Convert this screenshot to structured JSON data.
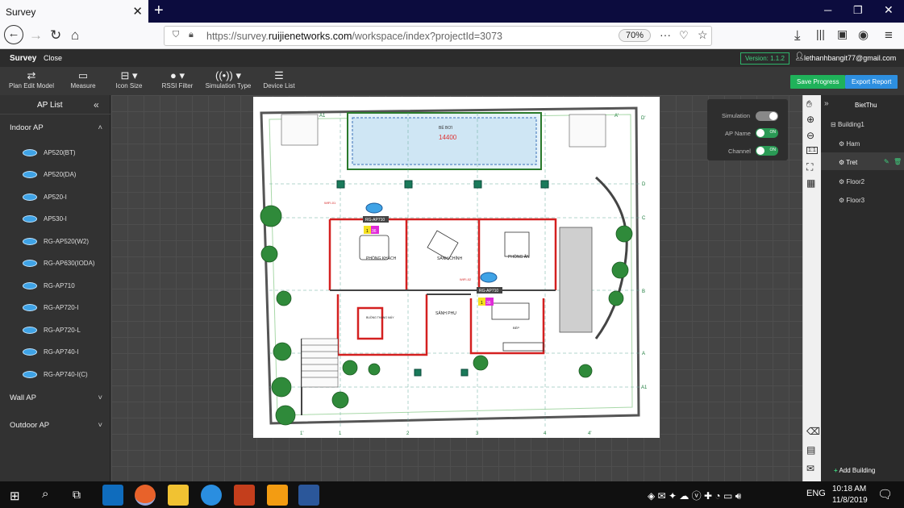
{
  "browser": {
    "tab_title": "Survey",
    "url_scheme": "https://survey.",
    "url_domain": "ruijienetworks.com",
    "url_path": "/workspace/index?projectId=3073",
    "zoom": "70%"
  },
  "header": {
    "app_name": "Survey",
    "close_label": "Close",
    "version": "Version: 1.1.2",
    "user": "lethanhbangit77@gmail.com"
  },
  "toolbar": {
    "plan_edit": "Plan Edit Model",
    "measure": "Measure",
    "icon_size": "Icon Size",
    "rssi_filter": "RSSI Filter",
    "simulation_type": "Simulation Type",
    "device_list": "Device List",
    "save_progress": "Save Progress",
    "export_report": "Export Report"
  },
  "ap_list": {
    "title": "AP List",
    "indoor": "Indoor AP",
    "items": [
      "AP520(BT)",
      "AP520(DA)",
      "AP520-I",
      "AP530-I",
      "RG-AP520(W2)",
      "RG-AP630(IODA)",
      "RG-AP710",
      "RG-AP720-I",
      "RG-AP720-L",
      "RG-AP740-I",
      "RG-AP740-I(C)"
    ],
    "wall": "Wall AP",
    "outdoor": "Outdoor AP"
  },
  "simulation": {
    "simulation_label": "Simulation",
    "ap_name_label": "AP Name",
    "channel_label": "Channel",
    "on_text": "ON"
  },
  "floorplan": {
    "pool_label": "BỂ BƠI",
    "pool_value": "14400",
    "room1": "PHÒNG KHÁCH",
    "room2": "SẢNH CHÍNH",
    "room3": "PHÒNG ĂN",
    "room4": "SẢNH PHỤ",
    "room5": "BUỒNG THANG MÁY",
    "room6": "BẾP",
    "ap1_label": "RG-AP710",
    "ap1_ch": "1",
    "ap1_pow": "36",
    "ap2_label": "RG-AP710",
    "ap2_ch": "1",
    "ap2_pow": "36",
    "wifi1": "WIFI-01",
    "wifi2": "WIFI-02",
    "axis_top": [
      "A1",
      "A'"
    ],
    "axis_bottom": [
      "1'",
      "1",
      "2",
      "3",
      "4",
      "4'"
    ],
    "axis_right": [
      "D'",
      "D",
      "C",
      "B",
      "A",
      "A1"
    ]
  },
  "building": {
    "name": "BietThu",
    "building": "Building1",
    "floors": [
      "Ham",
      "Tret",
      "Floor2",
      "Floor3"
    ],
    "add_building": "Add Building"
  },
  "taskbar": {
    "lang": "ENG",
    "time": "10:18 AM",
    "date": "11/8/2019"
  }
}
